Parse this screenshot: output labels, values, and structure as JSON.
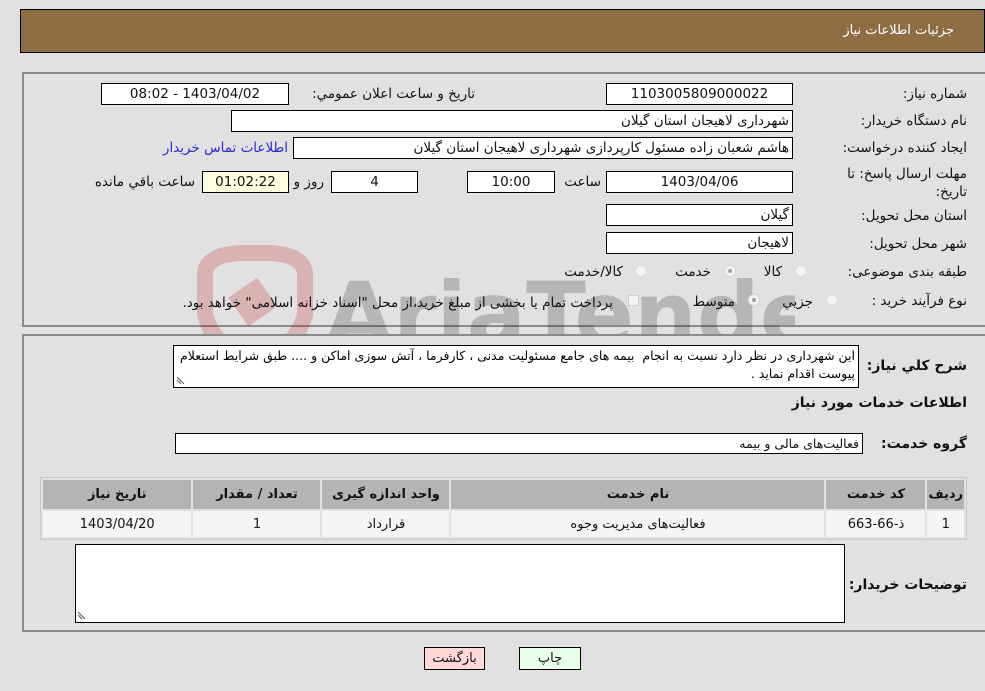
{
  "header": {
    "title": "جزئیات اطلاعات نیاز"
  },
  "form": {
    "need_number": {
      "label": "شماره نیاز:",
      "value": "1103005809000022"
    },
    "announce_datetime": {
      "label": "تاریخ و ساعت اعلان عمومي:",
      "value": "1403/04/02 - 08:02"
    },
    "buyer_org": {
      "label": "نام دستگاه خریدار:",
      "value": "شهرداری لاهیجان استان گیلان"
    },
    "requester": {
      "label": "ایجاد کننده درخواست:",
      "value": "هاشم شعبان زاده مسئول کارپردازی شهرداری لاهیجان استان گیلان"
    },
    "buyer_contact_link": "اطلاعات تماس خریدار",
    "deadline": {
      "label_line1": "مهلت ارسال پاسخ: تا",
      "label_line2": "تاریخ:",
      "date": "1403/04/06",
      "time_label": "ساعت",
      "time": "10:00",
      "days": "4",
      "days_label": "روز و",
      "remaining": "01:02:22",
      "remaining_label": "ساعت باقي مانده"
    },
    "province": {
      "label": "استان محل تحویل:",
      "value": "گیلان"
    },
    "city": {
      "label": "شهر محل تحویل:",
      "value": "لاهیجان"
    },
    "category": {
      "label": "طبقه بندی موضوعی:",
      "options": [
        "کالا",
        "خدمت",
        "کالا/خدمت"
      ],
      "selected": "خدمت"
    },
    "purchase_type": {
      "label": "نوع فرآیند خرید :",
      "options": [
        "جزيي",
        "متوسط"
      ],
      "selected": "متوسط",
      "treasury_note": "پرداخت تمام یا بخشی از مبلغ خرید،از محل \"اسناد خزانه اسلامی\" خواهد بود."
    }
  },
  "description": {
    "label": "شرح كلي نياز:",
    "value": "این شهرداری در نظر دارد نسبت به انجام  بیمه های جامع مسئولیت مدنی ، کارفرما ، آتش سوزی اماکن و .... طبق شرایط استعلام پیوست اقدام نماید ."
  },
  "services": {
    "section_title": "اطلاعات خدمات مورد نیاز",
    "group_label": "گروه خدمت:",
    "group_value": "فعالیت‌های مالی و بیمه",
    "columns": [
      "ردیف",
      "کد خدمت",
      "نام خدمت",
      "واحد اندازه گیری",
      "تعداد / مقدار",
      "تاریخ نیاز"
    ],
    "rows": [
      [
        "1",
        "ذ-66-663",
        "فعالیت‌های مدیریت وجوه",
        "قرارداد",
        "1",
        "1403/04/20"
      ]
    ]
  },
  "buyer_notes": {
    "label": "توضیحات خریدار:",
    "value": ""
  },
  "buttons": {
    "print": "چاپ",
    "back": "بازگشت"
  },
  "watermark": {
    "text": "AriaTender.neT"
  }
}
